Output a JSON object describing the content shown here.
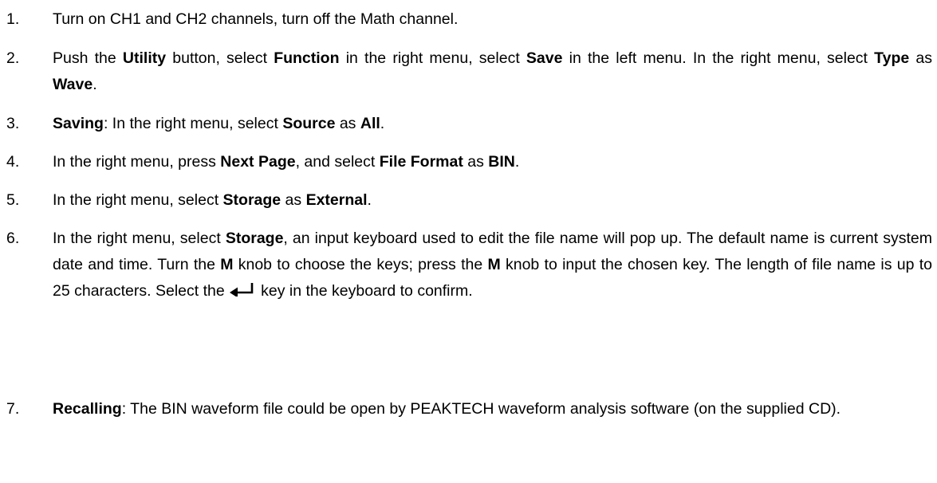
{
  "steps": [
    {
      "number": "1.",
      "parts": [
        {
          "t": "Turn on CH1 and CH2 channels, turn off the Math channel.",
          "b": false
        }
      ]
    },
    {
      "number": "2.",
      "parts": [
        {
          "t": "Push the ",
          "b": false
        },
        {
          "t": "Utility",
          "b": true
        },
        {
          "t": " button, select ",
          "b": false
        },
        {
          "t": "Function",
          "b": true
        },
        {
          "t": " in the right menu, select ",
          "b": false
        },
        {
          "t": "Save",
          "b": true
        },
        {
          "t": " in the left menu. In the right menu, select ",
          "b": false
        },
        {
          "t": "Type",
          "b": true
        },
        {
          "t": " as ",
          "b": false
        },
        {
          "t": "Wave",
          "b": true
        },
        {
          "t": ".",
          "b": false
        }
      ]
    },
    {
      "number": "3.",
      "parts": [
        {
          "t": "Saving",
          "b": true
        },
        {
          "t": ": In the right menu, select ",
          "b": false
        },
        {
          "t": "Source",
          "b": true
        },
        {
          "t": " as ",
          "b": false
        },
        {
          "t": "All",
          "b": true
        },
        {
          "t": ".",
          "b": false
        }
      ]
    },
    {
      "number": "4.",
      "parts": [
        {
          "t": "In the right menu, press ",
          "b": false
        },
        {
          "t": "Next Page",
          "b": true
        },
        {
          "t": ", and select ",
          "b": false
        },
        {
          "t": "File Format",
          "b": true
        },
        {
          "t": " as ",
          "b": false
        },
        {
          "t": "BIN",
          "b": true
        },
        {
          "t": ".",
          "b": false
        }
      ]
    },
    {
      "number": "5.",
      "parts": [
        {
          "t": "In the right menu, select ",
          "b": false
        },
        {
          "t": "Storage",
          "b": true
        },
        {
          "t": " as ",
          "b": false
        },
        {
          "t": "External",
          "b": true
        },
        {
          "t": ".",
          "b": false
        }
      ]
    },
    {
      "number": "6.",
      "parts": [
        {
          "t": "In the right menu, select ",
          "b": false
        },
        {
          "t": "Storage",
          "b": true
        },
        {
          "t": ", an input keyboard used to edit the file name will pop up. The default name is current system date and time. Turn the ",
          "b": false
        },
        {
          "t": "M",
          "b": true
        },
        {
          "t": " knob to choose the keys; press the ",
          "b": false
        },
        {
          "t": "M",
          "b": true
        },
        {
          "t": " knob to input the chosen key. The length of file name is up to 25 characters. Select the ",
          "b": false
        },
        {
          "icon": "enter-key-icon"
        },
        {
          "t": "key in the keyboard to confirm.",
          "b": false
        }
      ]
    },
    {
      "number": "7.",
      "parts": [
        {
          "t": "Recalling",
          "b": true
        },
        {
          "t": ": The BIN waveform file could be open by PEAKTECH waveform analysis software (on the supplied CD).",
          "b": false
        }
      ]
    }
  ]
}
